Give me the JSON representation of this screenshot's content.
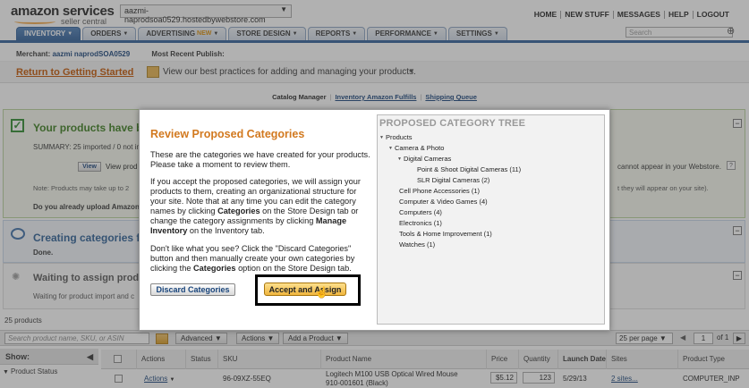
{
  "header": {
    "logo": "amazon services",
    "logo_sub": "seller central",
    "store_select": "aazmi-naprodsoa0529.hostedbywebstore.com",
    "topnav": [
      "HOME",
      "NEW STUFF",
      "MESSAGES",
      "HELP",
      "LOGOUT"
    ],
    "search_placeholder": "Search"
  },
  "tabs": [
    {
      "label": "INVENTORY",
      "active": true
    },
    {
      "label": "ORDERS",
      "active": false
    },
    {
      "label": "ADVERTISING",
      "badge": "NEW",
      "active": false
    },
    {
      "label": "STORE DESIGN",
      "active": false
    },
    {
      "label": "REPORTS",
      "active": false
    },
    {
      "label": "PERFORMANCE",
      "active": false
    },
    {
      "label": "SETTINGS",
      "active": false
    }
  ],
  "merchant": {
    "merchant_label": "Merchant:",
    "merchant_value": "aazmi naprodSOA0529",
    "recent_label": "Most Recent Publish:"
  },
  "return_bar": {
    "link": "Return to Getting Started",
    "best_practices": "View our best practices for adding and managing your products."
  },
  "catalog_nav": {
    "current": "Catalog Manager",
    "links": [
      "Inventory Amazon Fulfills",
      "Shipping Queue"
    ]
  },
  "panel1": {
    "title": "Your products have be",
    "summary": "SUMMARY: 25 imported / 0 not imported / 0",
    "view_button": "View",
    "view_text": "View prod",
    "right_note": "cannot appear in your Webstore.",
    "note": "Note: Products may take up to 2",
    "note_right": "t they will appear on your site).",
    "upload": "Do you already upload Amazon"
  },
  "panel2": {
    "title": "Creating categories fo",
    "done": "Done."
  },
  "panel3": {
    "title": "Waiting to assign product",
    "sub": "Waiting for product import and c"
  },
  "table": {
    "count": "25 products",
    "search_placeholder": "Search product name, SKU, or ASIN",
    "advanced": "Advanced",
    "actions": "Actions",
    "add_product": "Add a Product",
    "per_page": "25 per page",
    "page": "1",
    "of": "of 1",
    "show_label": "Show:",
    "filter": "Product Status",
    "columns": [
      "Actions",
      "Status",
      "SKU",
      "Product Name",
      "Price",
      "Quantity",
      "Launch Date",
      "Sites",
      "Product Type"
    ],
    "row": {
      "actions": "Actions",
      "sku": "96-09XZ-55EQ",
      "name_line1": "Logitech M100 USB Optical Wired Mouse",
      "name_line2": "910-001601 (Black)",
      "price": "$5.12",
      "quantity": "123",
      "launch": "5/29/13",
      "sites": "2 sites...",
      "type": "COMPUTER_INP"
    }
  },
  "modal": {
    "title": "Review Proposed Categories",
    "p1": "These are the categories we have created for your products. Please take a moment to review them.",
    "p2_a": "If you accept the proposed categories, we will assign your products to them, creating an organizational structure for your site. Note that at any time you can edit the category names by clicking ",
    "p2_b": "Categories",
    "p2_c": " on the Store Design tab or change the category assignments by clicking ",
    "p2_d": "Manage Inventory",
    "p2_e": " on the Inventory tab.",
    "p3_a": "Don't like what you see? Click the \"Discard Categories\" button and then manually create your own categories by clicking the ",
    "p3_b": "Categories",
    "p3_c": " option on the Store Design tab.",
    "discard": "Discard Categories",
    "accept": "Accept and Assign",
    "tree_title": "PROPOSED CATEGORY TREE",
    "tree": [
      {
        "label": "Products",
        "level": 0,
        "tri": true
      },
      {
        "label": "Camera & Photo",
        "level": 1,
        "tri": true
      },
      {
        "label": "Digital Cameras",
        "level": 2,
        "tri": true
      },
      {
        "label": "Point & Shoot Digital Cameras  (11)",
        "level": 3,
        "tri": false
      },
      {
        "label": "SLR Digital Cameras  (2)",
        "level": 3,
        "tri": false
      },
      {
        "label": "Cell Phone Accessories  (1)",
        "level": 1,
        "tri": false
      },
      {
        "label": "Computer & Video Games  (4)",
        "level": 1,
        "tri": false
      },
      {
        "label": "Computers  (4)",
        "level": 1,
        "tri": false
      },
      {
        "label": "Electronics  (1)",
        "level": 1,
        "tri": false
      },
      {
        "label": "Tools & Home Improvement  (1)",
        "level": 1,
        "tri": false
      },
      {
        "label": "Watches  (1)",
        "level": 1,
        "tri": false
      }
    ]
  }
}
